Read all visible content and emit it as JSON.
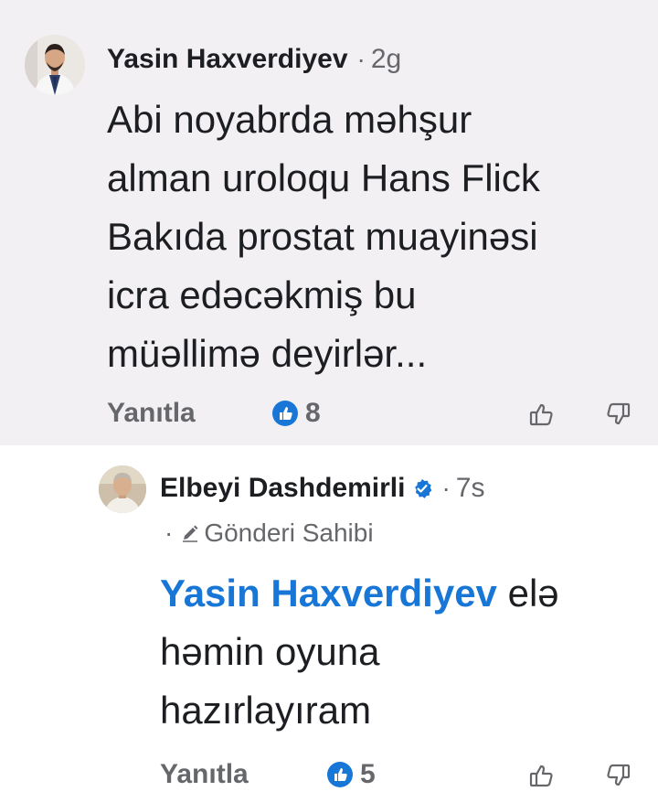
{
  "comments": [
    {
      "author": "Yasin Haxverdiyev",
      "separator": "·",
      "time": "2g",
      "lines": [
        "Abi noyabrda məhşur",
        "alman uroloqu Hans Flick",
        "Bakıda prostat muayinəsi",
        "icra edəcəkmiş bu",
        "müəllimə deyirlər..."
      ],
      "reply_label": "Yanıtla",
      "reaction_count": "8"
    },
    {
      "author": "Elbeyi Dashdemirli",
      "separator": "·",
      "time": "7s",
      "badge_dot": "·",
      "badge_label": "Gönderi Sahibi",
      "mention": "Yasin Haxverdiyev",
      "lines": [
        "elə",
        "həmin oyuna",
        "hazırlayıram"
      ],
      "reply_label": "Yanıtla",
      "reaction_count": "5"
    }
  ],
  "colors": {
    "accent_blue": "#1877d6",
    "secondary_text": "#65676b",
    "highlight_background": "#f3f0f3"
  },
  "icons": {
    "like_badge": "thumbs-up-badge-icon",
    "upvote": "thumbs-up-outline-icon",
    "downvote": "thumbs-down-outline-icon",
    "verified": "verified-badge-icon",
    "author_badge": "pencil-icon"
  }
}
